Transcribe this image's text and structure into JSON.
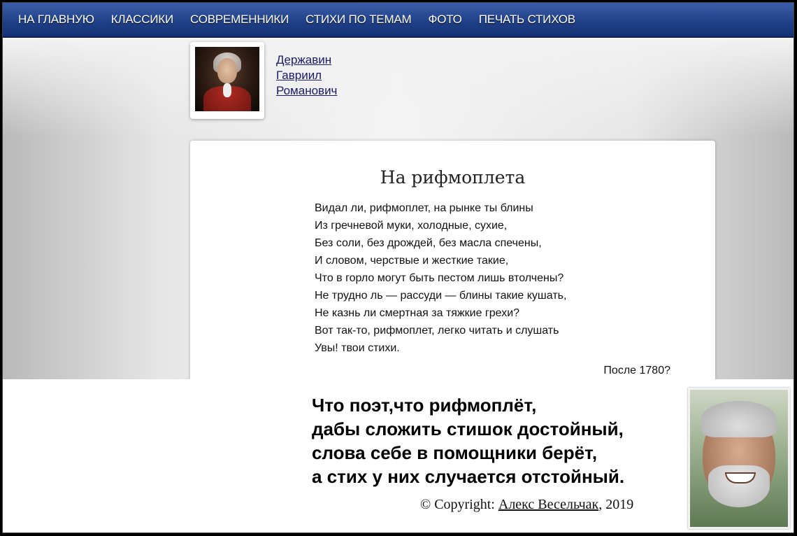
{
  "nav": {
    "items": [
      "НА ГЛАВНУЮ",
      "КЛАССИКИ",
      "СОВРЕМЕННИКИ",
      "СТИХИ ПО ТЕМАМ",
      "ФОТО",
      "ПЕЧАТЬ СТИХОВ"
    ]
  },
  "author": {
    "name_lines": [
      "Державин",
      "Гавриил",
      "Романович"
    ]
  },
  "poem": {
    "title": "На рифмоплета",
    "lines": [
      "Видал ли, рифмоплет, на рынке ты блины",
      "Из гречневой муки, холодные, сухие,",
      "Без соли, без дрождей, без масла спечены,",
      "И словом, черствые и жесткие такие,",
      "Что в горло могут быть пестом лишь втолчены?",
      "Не трудно ль — рассуди — блины такие кушать,",
      "Не казнь ли смертная за тяжкие грехи?",
      "Вот так-то, рифмоплет, легко читать и слушать",
      "Увы! твои стихи."
    ],
    "date": "После 1780?"
  },
  "reply": {
    "lines": [
      "Что поэт,что рифмоплёт,",
      "дабы сложить стишок достойный,",
      "слова себе в помощники берёт,",
      "а стих у них случается отстойный."
    ],
    "copyright_prefix": "© Copyright: ",
    "copyright_author": "Алекс Весельчак",
    "copyright_suffix": ", 2019"
  }
}
